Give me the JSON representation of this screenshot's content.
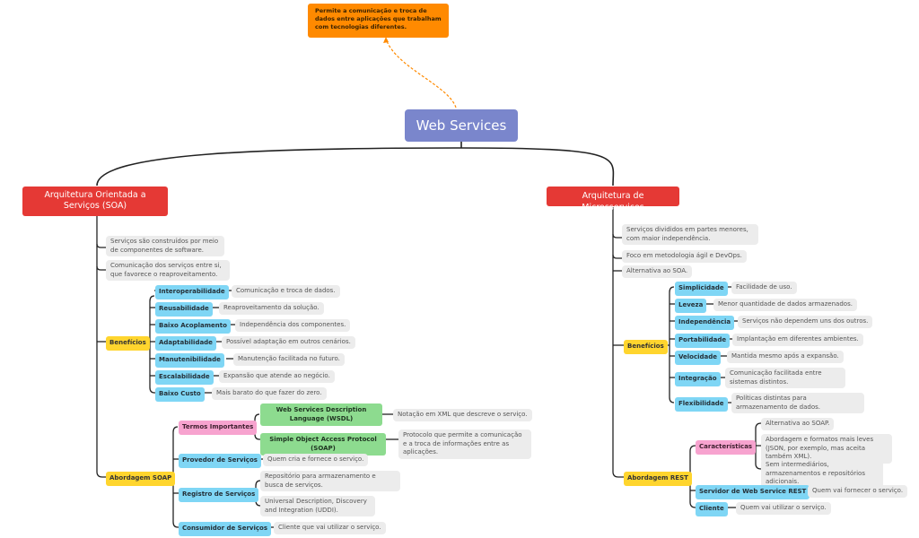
{
  "root": {
    "title": "Web Services"
  },
  "callout": {
    "text": "Permite a comunicação e troca de dados entre aplicações que trabalham com tecnologias diferentes."
  },
  "colors": {
    "root": "#7a86cc",
    "callout": "#ff8a00",
    "main": "#e53935",
    "yellow": "#ffd52e",
    "blue": "#7fd6f5",
    "pink": "#f7a3cf",
    "green": "#8ddb8f",
    "note": "#ececec"
  },
  "soa": {
    "title": "Arquitetura Orientada a Serviços (SOA)",
    "notes": [
      "Serviços são construídos por meio de componentes de software.",
      "Comunicação dos serviços entre si, que favorece o reaproveitamento."
    ],
    "benefits": {
      "label": "Benefícios",
      "items": [
        {
          "label": "Interoperabilidade",
          "desc": "Comunicação e troca de dados."
        },
        {
          "label": "Reusabilidade",
          "desc": "Reaproveitamento da solução."
        },
        {
          "label": "Baixo Acoplamento",
          "desc": "Independência dos componentes."
        },
        {
          "label": "Adaptabilidade",
          "desc": "Possível adaptação em outros cenários."
        },
        {
          "label": "Manutenibilidade",
          "desc": "Manutenção facilitada no futuro."
        },
        {
          "label": "Escalabilidade",
          "desc": "Expansão que atende ao negócio."
        },
        {
          "label": "Baixo Custo",
          "desc": "Mais barato do que fazer do zero."
        }
      ]
    },
    "soap": {
      "label": "Abordagem SOAP",
      "terms": {
        "label": "Termos Importantes",
        "items": [
          {
            "label": "Web Services Description Language (WSDL)",
            "desc": "Notação em XML que descreve o serviço."
          },
          {
            "label": "Simple Object Access Protocol (SOAP)",
            "desc": "Protocolo que permite a comunicação e a troca de informações entre as aplicações."
          }
        ]
      },
      "provider": {
        "label": "Provedor de Serviços",
        "desc": "Quem cria e fornece o serviço."
      },
      "registry": {
        "label": "Registro de Serviços",
        "descs": [
          "Repositório para armazenamento e busca de serviços.",
          "Universal Description, Discovery and Integration (UDDI)."
        ]
      },
      "consumer": {
        "label": "Consumidor de Serviços",
        "desc": "Cliente que vai utilizar o serviço."
      }
    }
  },
  "micro": {
    "title": "Arquitetura de Microsserviços",
    "notes": [
      "Serviços divididos em partes menores, com maior independência.",
      "Foco em metodologia ágil e DevOps.",
      "Alternativa ao SOA."
    ],
    "benefits": {
      "label": "Benefícios",
      "items": [
        {
          "label": "Simplicidade",
          "desc": "Facilidade de uso."
        },
        {
          "label": "Leveza",
          "desc": "Menor quantidade de dados armazenados."
        },
        {
          "label": "Independência",
          "desc": "Serviços não dependem uns dos outros."
        },
        {
          "label": "Portabilidade",
          "desc": "Implantação em diferentes ambientes."
        },
        {
          "label": "Velocidade",
          "desc": "Mantida mesmo após a expansão."
        },
        {
          "label": "Integração",
          "desc": "Comunicação facilitada entre sistemas distintos."
        },
        {
          "label": "Flexibilidade",
          "desc": "Políticas distintas para armazenamento de dados."
        }
      ]
    },
    "rest": {
      "label": "Abordagem REST",
      "features": {
        "label": "Características",
        "items": [
          "Alternativa ao SOAP.",
          "Abordagem e formatos mais leves (JSON, por exemplo, mas aceita também XML).",
          "Sem intermediários, armazenamentos e repositórios adicionais."
        ]
      },
      "server": {
        "label": "Servidor de Web Service REST",
        "desc": "Quem vai fornecer o serviço."
      },
      "client": {
        "label": "Cliente",
        "desc": "Quem vai utilizar o serviço."
      }
    }
  }
}
